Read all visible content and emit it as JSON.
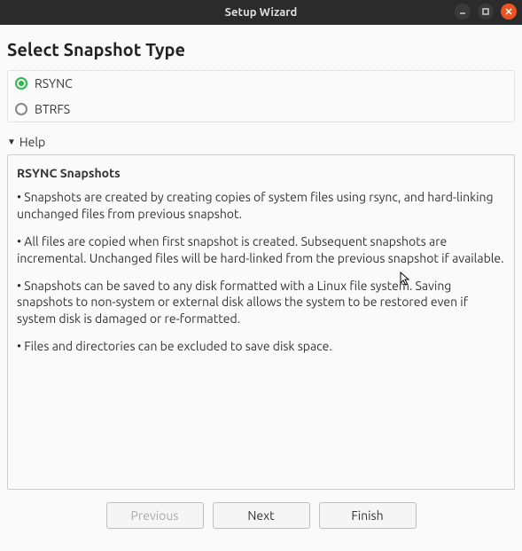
{
  "window": {
    "title": "Setup Wizard"
  },
  "page": {
    "heading": "Select Snapshot Type"
  },
  "options": {
    "rsync": {
      "label": "RSYNC",
      "selected": true
    },
    "btrfs": {
      "label": "BTRFS",
      "selected": false
    }
  },
  "help": {
    "toggle_label": "Help",
    "title": "RSYNC Snapshots",
    "p1": "• Snapshots are created by creating copies of system files using rsync, and hard-linking unchanged files from previous snapshot.",
    "p2": "• All files are copied when first snapshot is created. Subsequent snapshots are incremental. Unchanged files will be hard-linked from the previous snapshot if available.",
    "p3": "• Snapshots can be saved to any disk formatted with a Linux file system. Saving snapshots to non-system or external disk allows the system to be restored even if system disk is damaged or re-formatted.",
    "p4": "• Files and directories can be excluded to save disk space."
  },
  "buttons": {
    "previous": "Previous",
    "next": "Next",
    "finish": "Finish"
  }
}
